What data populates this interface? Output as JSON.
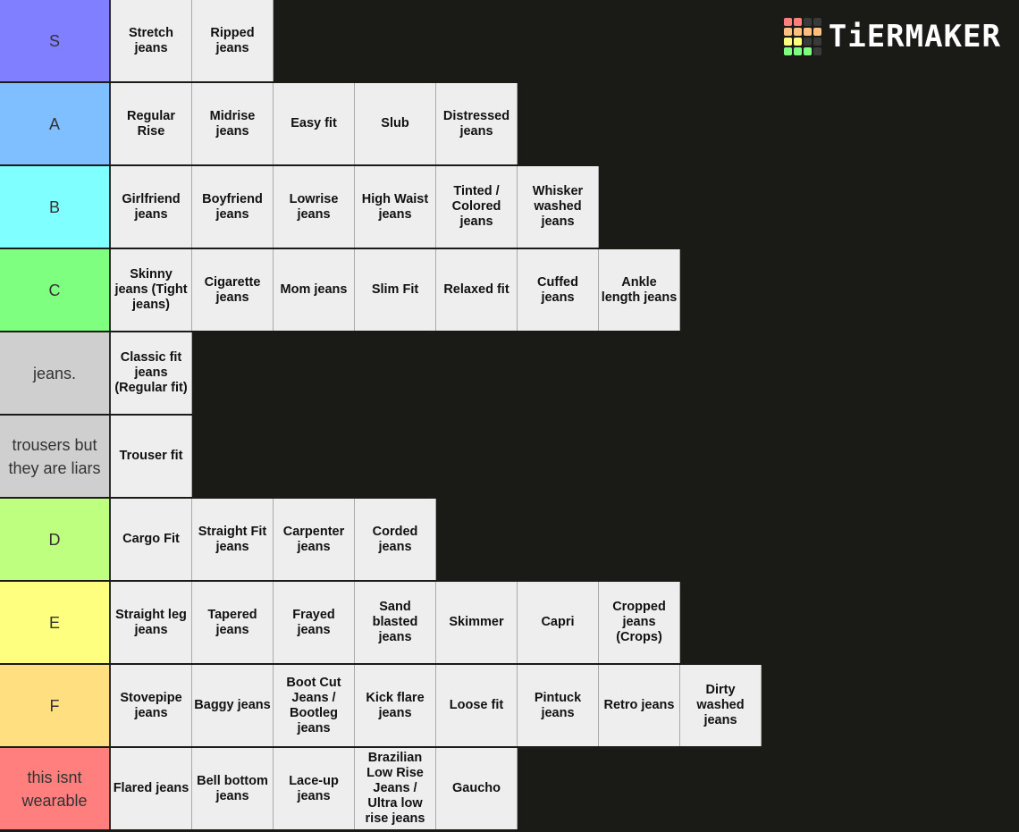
{
  "app": {
    "logo_text": "TiERMAKER"
  },
  "logo_grid_colors": [
    "#ff7f7f",
    "#ff7f7f",
    "#3a3a3a",
    "#3a3a3a",
    "#ffbf7f",
    "#ffbf7f",
    "#ffbf7f",
    "#ffbf7f",
    "#ffff7f",
    "#ffff7f",
    "#3a3a3a",
    "#3a3a3a",
    "#7fff7f",
    "#7fff7f",
    "#7fff7f",
    "#3a3a3a"
  ],
  "tiers": [
    {
      "label": "S",
      "color": "#7f7fff",
      "items": [
        "Stretch jeans",
        "Ripped jeans"
      ]
    },
    {
      "label": "A",
      "color": "#7fbfff",
      "items": [
        "Regular Rise",
        "Midrise jeans",
        "Easy fit",
        "Slub",
        "Distressed jeans"
      ]
    },
    {
      "label": "B",
      "color": "#7fffff",
      "items": [
        "Girlfriend jeans",
        "Boyfriend jeans",
        "Lowrise jeans",
        "High Waist jeans",
        "Tinted / Colored jeans",
        "Whisker washed jeans"
      ]
    },
    {
      "label": "C",
      "color": "#7fff7f",
      "items": [
        "Skinny jeans (Tight jeans)",
        "Cigarette jeans",
        "Mom jeans",
        "Slim Fit",
        "Relaxed fit",
        "Cuffed jeans",
        "Ankle length jeans"
      ]
    },
    {
      "label": "jeans.",
      "color": "#cfcfcf",
      "items": [
        "Classic fit jeans (Regular fit)"
      ]
    },
    {
      "label": "trousers but they are liars",
      "color": "#cfcfcf",
      "items": [
        "Trouser fit"
      ]
    },
    {
      "label": "D",
      "color": "#bfff7f",
      "items": [
        "Cargo Fit",
        "Straight Fit jeans",
        "Carpenter jeans",
        "Corded jeans"
      ]
    },
    {
      "label": "E",
      "color": "#ffff7f",
      "items": [
        "Straight leg jeans",
        "Tapered jeans",
        "Frayed jeans",
        "Sand blasted jeans",
        "Skimmer",
        "Capri",
        "Cropped jeans (Crops)"
      ]
    },
    {
      "label": "F",
      "color": "#ffdf7f",
      "items": [
        "Stovepipe jeans",
        "Baggy jeans",
        "Boot Cut Jeans / Bootleg jeans",
        "Kick flare jeans",
        "Loose fit",
        "Pintuck jeans",
        "Retro jeans",
        "Dirty washed jeans"
      ]
    },
    {
      "label": "this isnt wearable",
      "color": "#ff7f7f",
      "items": [
        "Flared jeans",
        "Bell bottom jeans",
        "Lace-up jeans",
        "Brazilian Low Rise Jeans / Ultra low rise jeans",
        "Gaucho"
      ]
    }
  ]
}
